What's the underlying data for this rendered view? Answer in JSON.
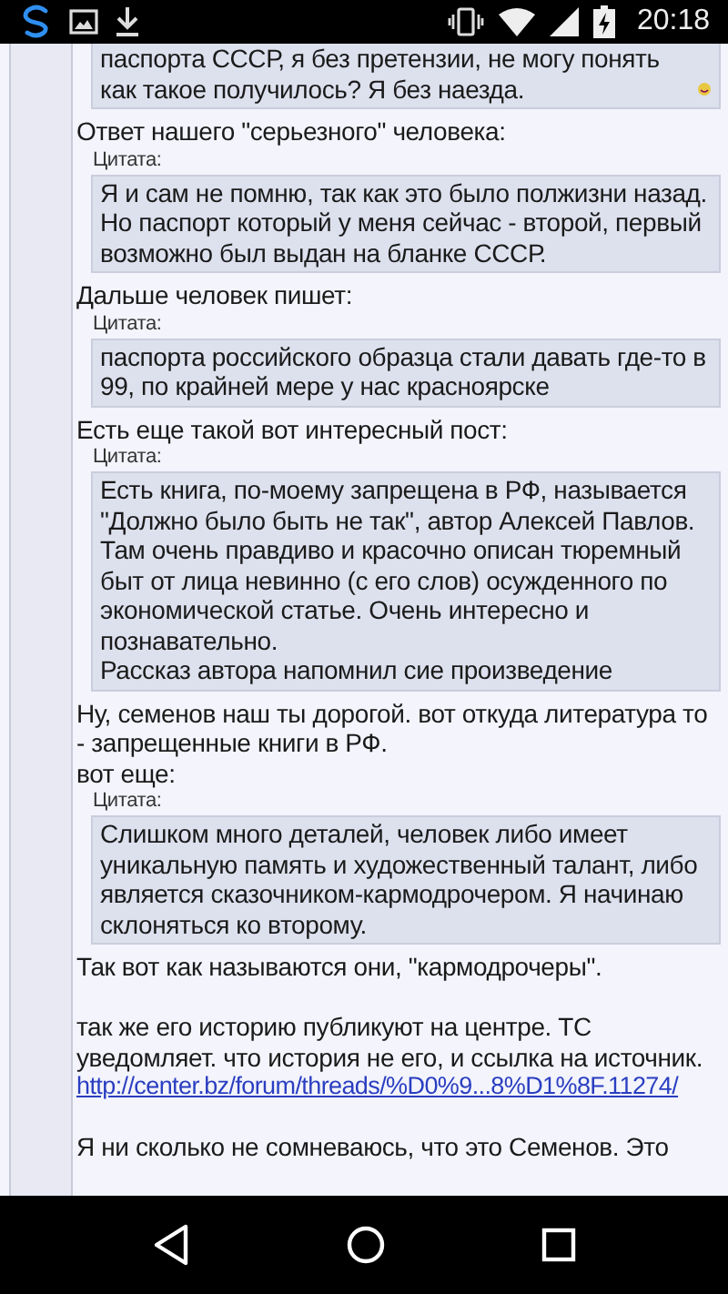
{
  "status_bar": {
    "time": "20:18"
  },
  "blocks": [
    {
      "kind": "quote",
      "text": "паспорта СССР, я без претензии, не могу понять как такое получилось? Я без наезда.",
      "emoticon": true
    },
    {
      "kind": "text",
      "text": "Ответ нашего \"серьезного\" человека:"
    },
    {
      "kind": "quote",
      "label": "Цитата:",
      "text": "Я и сам не помню, так как это было полжизни назад. Но паспорт который у меня сейчас - второй, первый возможно был выдан на бланке СССР."
    },
    {
      "kind": "text",
      "text": "Дальше человек пишет:"
    },
    {
      "kind": "quote",
      "label": "Цитата:",
      "text": "паспорта российского образца стали давать где-то в 99, по крайней мере у нас красноярске"
    },
    {
      "kind": "text",
      "text": "Есть еще такой вот интересный пост:"
    },
    {
      "kind": "quote",
      "label": "Цитата:",
      "text": "Есть книга, по-моему запрещена в РФ, называется \"Должно было быть не так\", автор Алексей Павлов. Там очень правдиво и красочно описан тюремный быт от лица невинно (с его слов) осужденного по экономической статье. Очень интересно и познавательно.\nРассказ автора напомнил сие произведение"
    },
    {
      "kind": "text",
      "text": "Ну, семенов наш ты дорогой. вот откуда литература то - запрещенные книги в РФ.\nвот еще:"
    },
    {
      "kind": "quote",
      "label": "Цитата:",
      "text": "Слишком много деталей, человек либо имеет уникальную память и художественный талант, либо является сказочником-кармодрочером. Я начинаю склоняться ко второму."
    },
    {
      "kind": "text",
      "text": "Так вот как называются они, \"кармодрочеры\"."
    },
    {
      "kind": "text",
      "gap": true,
      "text": "так же его историю публикуют на центре. ТС уведомляет. что история не его, и ссылка на источник."
    },
    {
      "kind": "link",
      "text": "http://center.bz/forum/threads/%D0%9...8%D1%8F.11274/"
    },
    {
      "kind": "text",
      "gap": true,
      "text": "Я ни сколько не сомневаюсь, что это Семенов. Это"
    }
  ]
}
